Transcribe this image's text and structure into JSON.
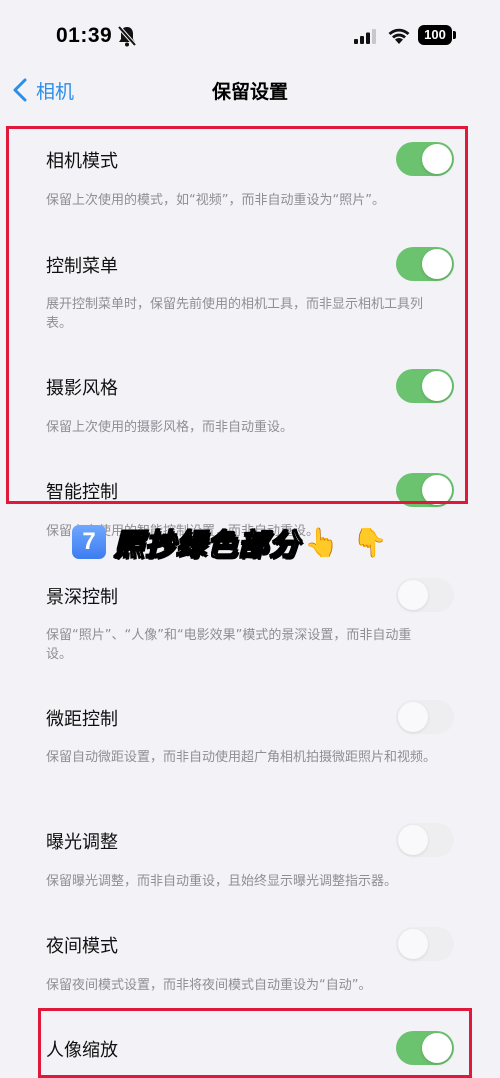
{
  "status_bar": {
    "time": "01:39",
    "battery": "100"
  },
  "nav": {
    "back_label": "相机",
    "title": "保留设置"
  },
  "settings": [
    {
      "label": "相机模式",
      "desc": "保留上次使用的模式，如“视频”，而非自动重设为“照片”。",
      "on": true
    },
    {
      "label": "控制菜单",
      "desc": "展开控制菜单时，保留先前使用的相机工具，而非显示相机工具列表。",
      "on": true
    },
    {
      "label": "摄影风格",
      "desc": "保留上次使用的摄影风格，而非自动重设。",
      "on": true
    },
    {
      "label": "智能控制",
      "desc": "保留上次使用的智能控制设置，而非自动重设。",
      "on": true
    },
    {
      "label": "景深控制",
      "desc": "保留“照片”、“人像”和“电影效果”模式的景深设置，而非自动重设。",
      "on": false
    },
    {
      "label": "微距控制",
      "desc": "保留自动微距设置，而非自动使用超广角相机拍摄微距照片和视频。",
      "on": false
    },
    {
      "label": "曝光调整",
      "desc": "保留曝光调整，而非自动重设，且始终显示曝光调整指示器。",
      "on": false
    },
    {
      "label": "夜间模式",
      "desc": "保留夜间模式设置，而非将夜间模式自动重设为“自动”。",
      "on": false
    },
    {
      "label": "人像缩放",
      "desc": "",
      "on": true
    }
  ],
  "overlay": {
    "keycap": "7",
    "caption": "照抄绿色部分",
    "emoji1": "👆",
    "emoji2": "👇"
  },
  "colors": {
    "accent": "#2d8ee8",
    "toggle_on": "#6cc36f",
    "toggle_off": "#ececec",
    "highlight": "#e0183c"
  }
}
